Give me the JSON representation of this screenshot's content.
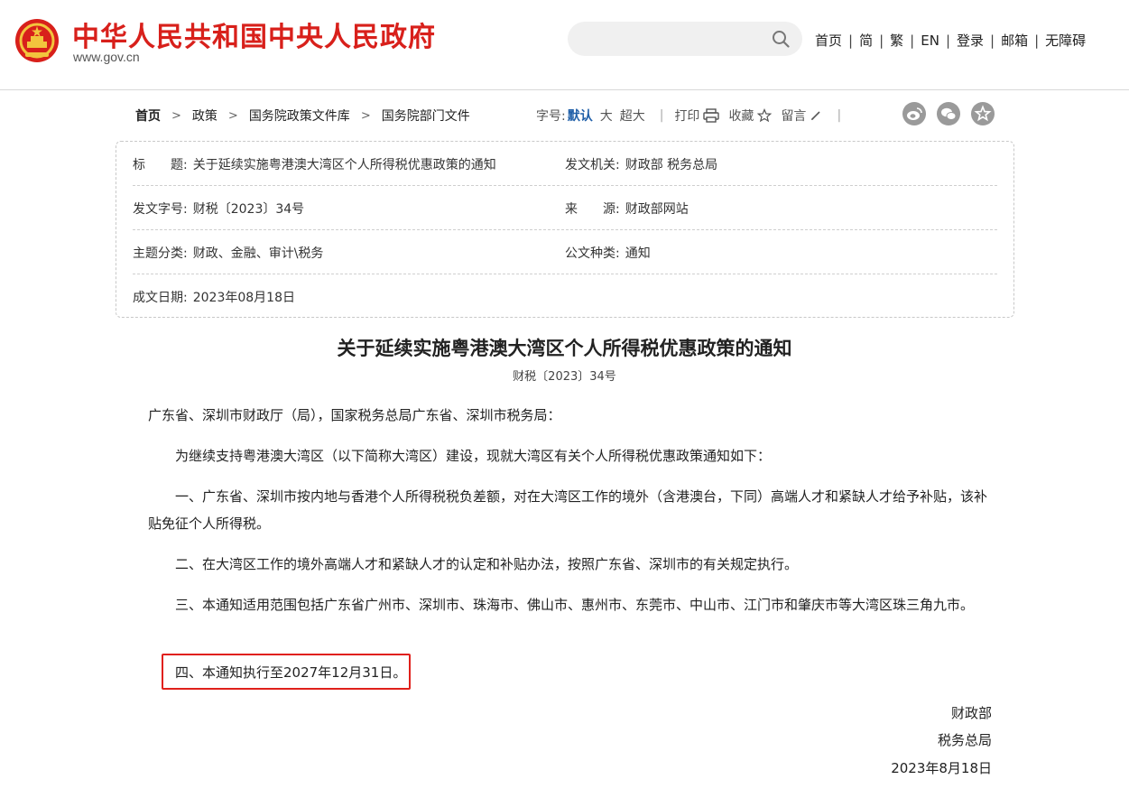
{
  "header": {
    "site_title": "中华人民共和国中央人民政府",
    "site_domain": "www.gov.cn",
    "search": {
      "placeholder": ""
    },
    "nav": [
      "首页",
      "简",
      "繁",
      "EN",
      "登录",
      "邮箱",
      "无障碍"
    ],
    "nav_separator": "|"
  },
  "breadcrumb": {
    "items": [
      "首页",
      "政策",
      "国务院政策文件库",
      "国务院部门文件"
    ],
    "chevron": ">"
  },
  "tools": {
    "font_size_label": "字号:",
    "font_sizes": [
      "默认",
      "大",
      "超大"
    ],
    "active_font_size": "默认",
    "separator": "|",
    "print": "打印",
    "favorite": "收藏",
    "comment": "留言"
  },
  "colors": {
    "brand_red": "#d8201b",
    "link_blue": "#1f5fa8",
    "highlight_red": "#e0201b"
  },
  "info": {
    "title_label": "标　　题:",
    "title_value": "关于延续实施粤港澳大湾区个人所得税优惠政策的通知",
    "issuer_label": "发文机关:",
    "issuer_value": "财政部 税务总局",
    "doc_no_label": "发文字号:",
    "doc_no_value": "财税〔2023〕34号",
    "source_label": "来　　源:",
    "source_value": "财政部网站",
    "category_label": "主题分类:",
    "category_value": "财政、金融、审计\\税务",
    "doc_type_label": "公文种类:",
    "doc_type_value": "通知",
    "date_label": "成文日期:",
    "date_value": "2023年08月18日"
  },
  "article": {
    "title": "关于延续实施粤港澳大湾区个人所得税优惠政策的通知",
    "doc_no": "财税〔2023〕34号",
    "addressee": "广东省、深圳市财政厅（局），国家税务总局广东省、深圳市税务局：",
    "intro": "为继续支持粤港澳大湾区（以下简称大湾区）建设，现就大湾区有关个人所得税优惠政策通知如下：",
    "item1": "一、广东省、深圳市按内地与香港个人所得税税负差额，对在大湾区工作的境外（含港澳台，下同）高端人才和紧缺人才给予补贴，该补贴免征个人所得税。",
    "item2": "二、在大湾区工作的境外高端人才和紧缺人才的认定和补贴办法，按照广东省、深圳市的有关规定执行。",
    "item3": "三、本通知适用范围包括广东省广州市、深圳市、珠海市、佛山市、惠州市、东莞市、中山市、江门市和肇庆市等大湾区珠三角九市。",
    "item4": "四、本通知执行至2027年12月31日。",
    "signature": [
      "财政部",
      "税务总局",
      "2023年8月18日"
    ]
  }
}
